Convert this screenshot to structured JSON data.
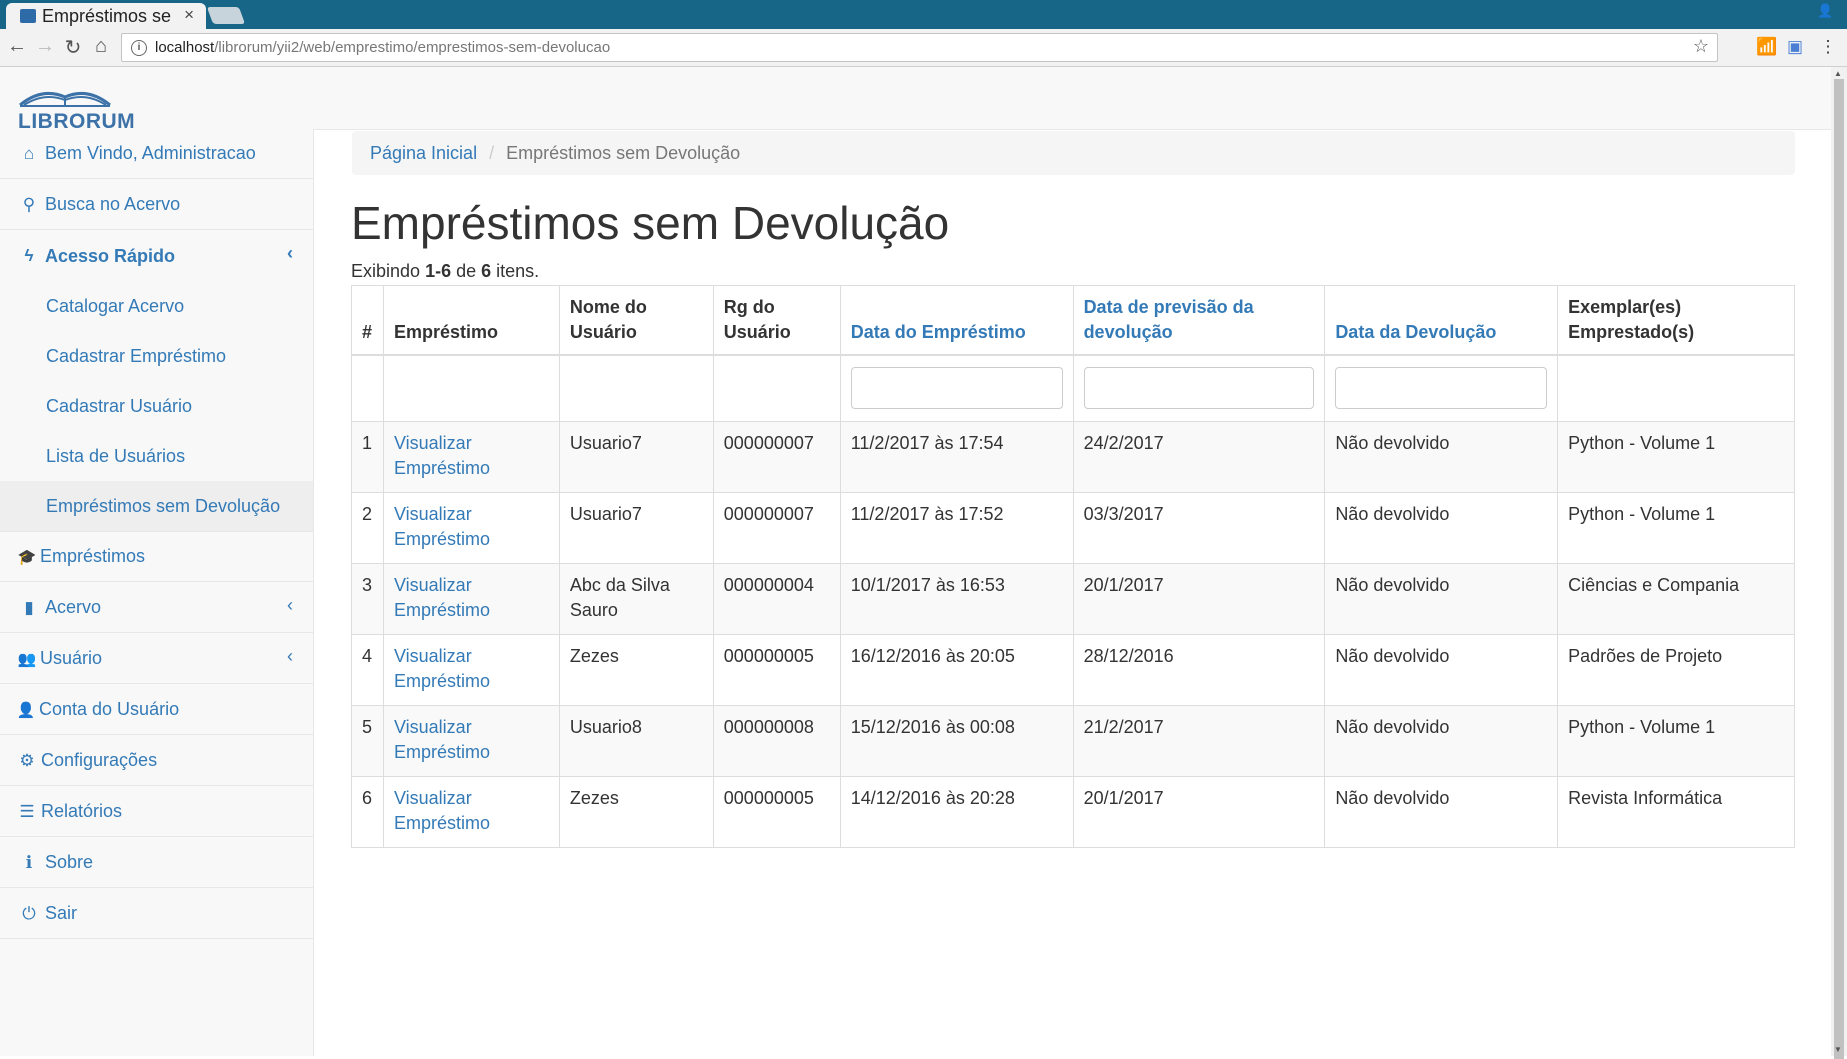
{
  "browser": {
    "tab_title": "Empréstimos se",
    "tab_close": "×",
    "url_host": "localhost",
    "url_path": "/librorum/yii2/web/emprestimo/emprestimos-sem-devolucao"
  },
  "logo": {
    "text": "LIBRORUM"
  },
  "sidebar": {
    "items": [
      {
        "label": "Bem Vindo, Administracao",
        "icon": "home-icon",
        "glyph": "⌂"
      },
      {
        "label": "Busca no Acervo",
        "icon": "search-icon",
        "glyph": "⚲"
      },
      {
        "label": "Acesso Rápido",
        "icon": "flash-icon",
        "glyph": "ϟ"
      },
      {
        "label": "Empréstimos",
        "icon": "graduation-cap-icon",
        "glyph": "🎓"
      },
      {
        "label": "Acervo",
        "icon": "book-icon",
        "glyph": "▮"
      },
      {
        "label": "Usuário",
        "icon": "users-icon",
        "glyph": "👥"
      },
      {
        "label": "Conta do Usuário",
        "icon": "user-icon",
        "glyph": "👤"
      },
      {
        "label": "Configurações",
        "icon": "gear-icon",
        "glyph": "⚙"
      },
      {
        "label": "Relatórios",
        "icon": "list-icon",
        "glyph": "☰"
      },
      {
        "label": "Sobre",
        "icon": "info-icon",
        "glyph": "ℹ"
      },
      {
        "label": "Sair",
        "icon": "power-icon",
        "glyph": "⏻"
      }
    ],
    "submenu": [
      "Catalogar Acervo",
      "Cadastrar Empréstimo",
      "Cadastrar Usuário",
      "Lista de Usuários",
      "Empréstimos sem Devolução"
    ]
  },
  "breadcrumb": {
    "home": "Página Inicial",
    "current": "Empréstimos sem Devolução"
  },
  "page": {
    "title": "Empréstimos sem Devolução",
    "summary_prefix": "Exibindo ",
    "summary_range": "1-6",
    "summary_mid": " de ",
    "summary_total": "6",
    "summary_suffix": " itens."
  },
  "table": {
    "headers": [
      "#",
      "Empréstimo",
      "Nome do Usuário",
      "Rg do Usuário",
      "Data do Empréstimo",
      "Data de previsão da devolução",
      "Data da Devolução",
      "Exemplar(es) Emprestado(s)"
    ],
    "rows": [
      [
        "1",
        "Visualizar Empréstimo",
        "Usuario7",
        "000000007",
        "11/2/2017 às 17:54",
        "24/2/2017",
        "Não devolvido",
        "Python - Volume 1"
      ],
      [
        "2",
        "Visualizar Empréstimo",
        "Usuario7",
        "000000007",
        "11/2/2017 às 17:52",
        "03/3/2017",
        "Não devolvido",
        "Python - Volume 1"
      ],
      [
        "3",
        "Visualizar Empréstimo",
        "Abc da Silva Sauro",
        "000000004",
        "10/1/2017 às 16:53",
        "20/1/2017",
        "Não devolvido",
        "Ciências e Compania"
      ],
      [
        "4",
        "Visualizar Empréstimo",
        "Zezes",
        "000000005",
        "16/12/2016 às 20:05",
        "28/12/2016",
        "Não devolvido",
        "Padrões de Projeto"
      ],
      [
        "5",
        "Visualizar Empréstimo",
        "Usuario8",
        "000000008",
        "15/12/2016 às 00:08",
        "21/2/2017",
        "Não devolvido",
        "Python - Volume 1"
      ],
      [
        "6",
        "Visualizar Empréstimo",
        "Zezes",
        "000000005",
        "14/12/2016 às 20:28",
        "20/1/2017",
        "Não devolvido",
        "Revista Informática"
      ]
    ]
  },
  "colors": {
    "link": "#337ab7",
    "chrome": "#176688",
    "sidebar_bg": "#f8f8f8"
  }
}
